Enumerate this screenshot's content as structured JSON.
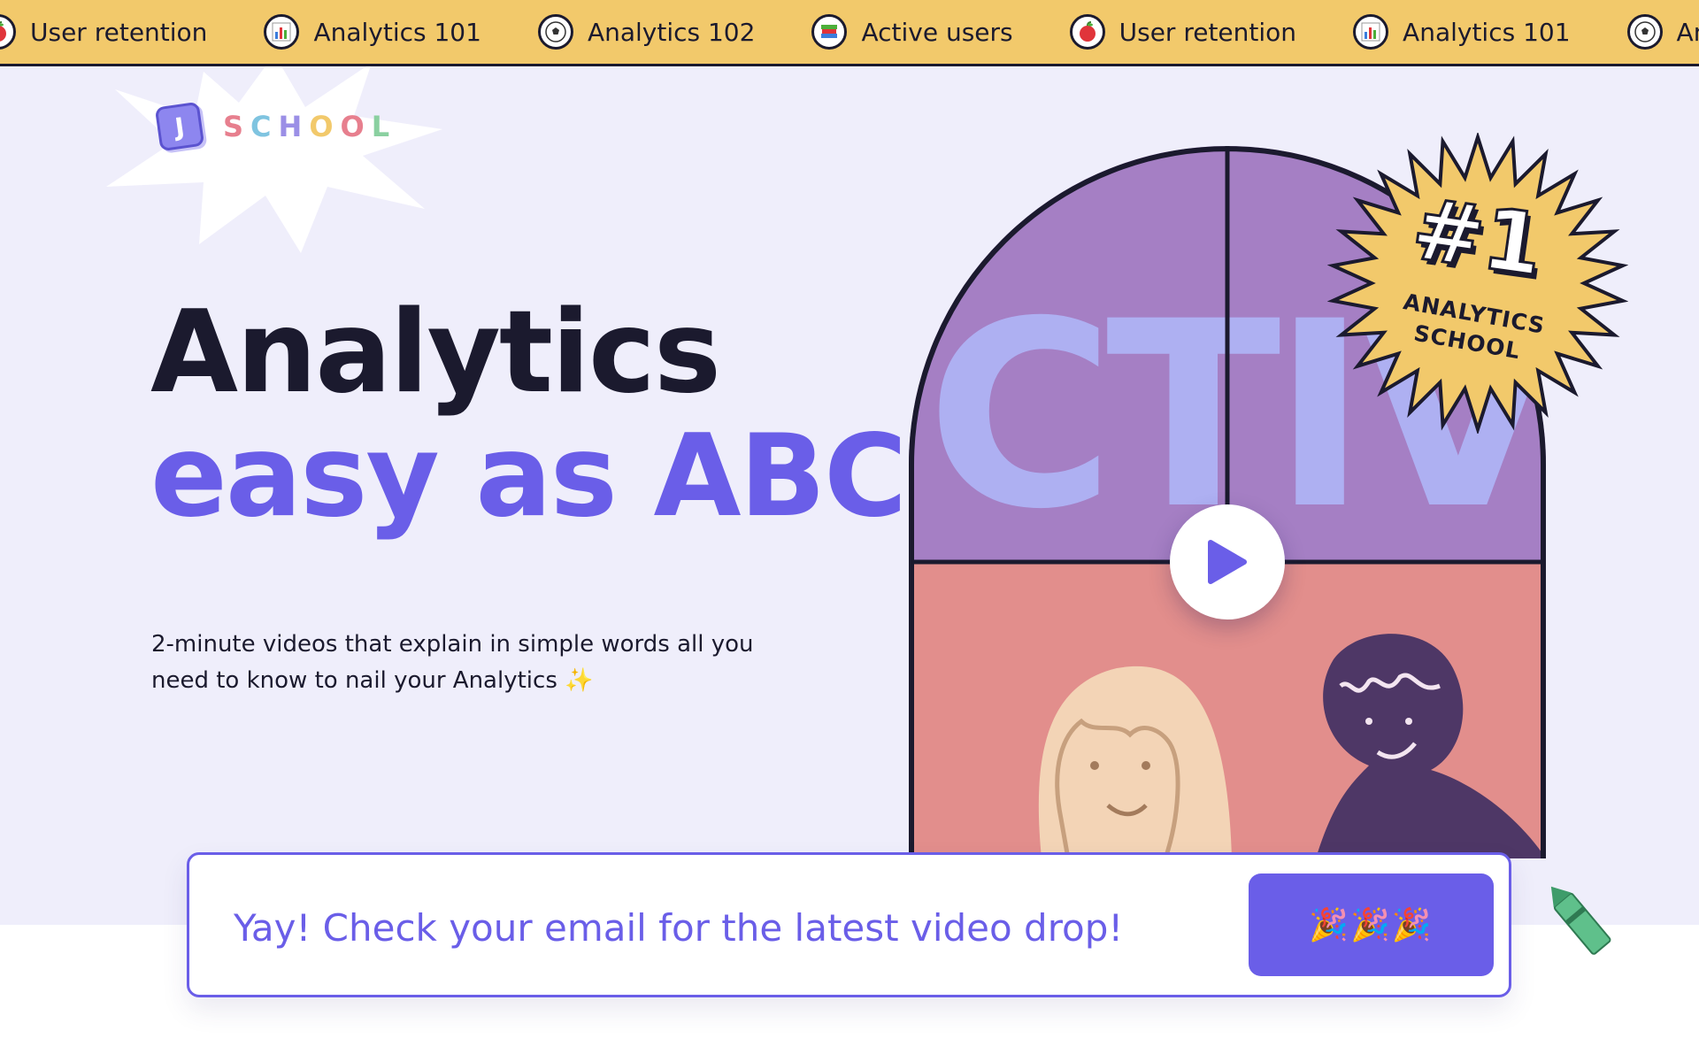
{
  "ticker": {
    "items": [
      {
        "label": "User retention",
        "icon": "apple-icon"
      },
      {
        "label": "Analytics 101",
        "icon": "bar-chart-icon"
      },
      {
        "label": "Analytics 102",
        "icon": "soccer-ball-icon"
      },
      {
        "label": "Active users",
        "icon": "books-icon"
      },
      {
        "label": "User retention",
        "icon": "apple-icon"
      },
      {
        "label": "Analytics 101",
        "icon": "bar-chart-icon"
      },
      {
        "label": "Analytic",
        "icon": "soccer-ball-icon"
      }
    ]
  },
  "logo": {
    "mark": "J",
    "word": "SCHOOL"
  },
  "hero": {
    "headline_line1": "Analytics",
    "headline_line2": "easy as ABC",
    "subtitle": "2-minute videos that explain in simple words all you need to know to nail your Analytics",
    "subtitle_emoji": "✨"
  },
  "video": {
    "cover_text": "CTIV"
  },
  "badge": {
    "number": "#1",
    "line1": "ANALYTICS",
    "line2": "SCHOOL"
  },
  "form": {
    "message": "Yay! Check your email for the latest video drop!",
    "button_label": "🎉🎉🎉"
  },
  "colors": {
    "ticker_bg": "#f2c96b",
    "hero_bg": "#efeefb",
    "accent": "#6a5ee8",
    "dark": "#1b1a2e",
    "window_top": "#a57fc4",
    "window_bottom": "#e28e8c"
  }
}
